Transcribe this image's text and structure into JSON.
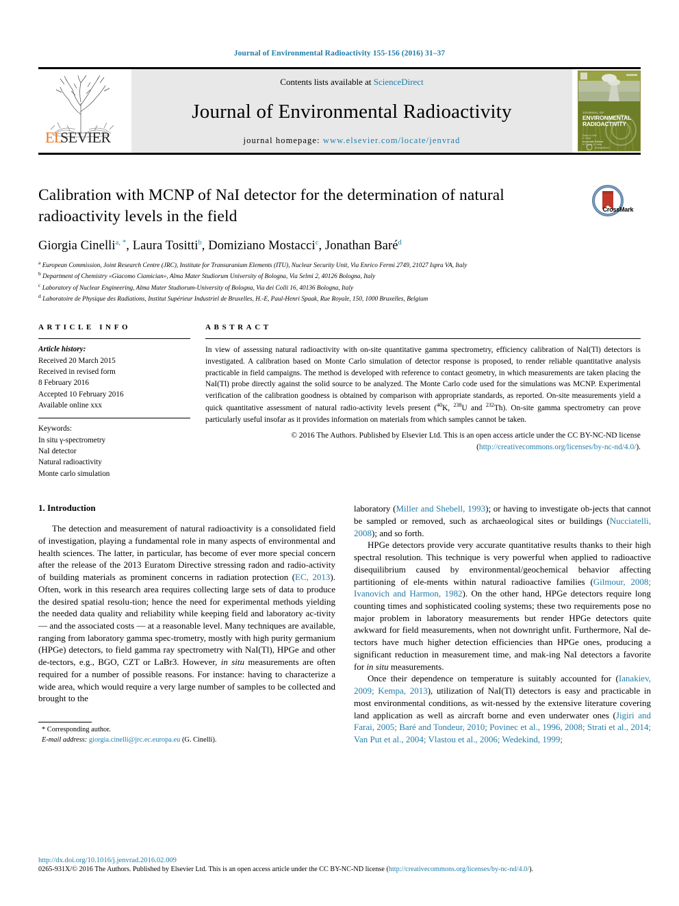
{
  "running_head": "Journal of Environmental Radioactivity 155-156 (2016) 31–37",
  "masthead": {
    "contents_prefix": "Contents lists available at ",
    "contents_link": "ScienceDirect",
    "journal_title": "Journal of Environmental Radioactivity",
    "homepage_prefix": "journal homepage: ",
    "homepage_url": "www.elsevier.com/locate/jenvrad",
    "publisher_logo": "ELSEVIER",
    "cover_title_small": "JOURNAL OF",
    "cover_title_1": "ENVIRONMENTAL",
    "cover_title_2": "RADIOACTIVITY"
  },
  "article": {
    "title": "Calibration with MCNP of NaI detector for the determination of natural radioactivity levels in the field",
    "crossmark_label": "CrossMark",
    "authors": [
      {
        "name": "Giorgia Cinelli",
        "marks": "a, *"
      },
      {
        "name": "Laura Tositti",
        "marks": "b"
      },
      {
        "name": "Domiziano Mostacci",
        "marks": "c"
      },
      {
        "name": "Jonathan Baré",
        "marks": "d"
      }
    ],
    "affiliations": [
      {
        "mark": "a",
        "text": "European Commission, Joint Research Centre (JRC), Institute for Transuranium Elements (ITU), Nuclear Security Unit, Via Enrico Fermi 2749, 21027 Ispra VA, Italy"
      },
      {
        "mark": "b",
        "text": "Department of Chemistry «Giacomo Ciamician», Alma Mater Studiorum University of Bologna, Via Selmi 2, 40126 Bologna, Italy"
      },
      {
        "mark": "c",
        "text": "Laboratory of Nuclear Engineering, Alma Mater Studiorum-University of Bologna, Via dei Colli 16, 40136 Bologna, Italy"
      },
      {
        "mark": "d",
        "text": "Laboratoire de Physique des Radiations, Institut Supérieur Industriel de Bruxelles, H.-E, Paul-Henri Spaak, Rue Royale, 150, 1000 Bruxelles, Belgium"
      }
    ]
  },
  "article_info": {
    "heading": "ARTICLE INFO",
    "history_label": "Article history:",
    "history": [
      "Received 20 March 2015",
      "Received in revised form",
      "8 February 2016",
      "Accepted 10 February 2016",
      "Available online xxx"
    ],
    "keywords_label": "Keywords:",
    "keywords": [
      "In situ γ-spectrometry",
      "NaI detector",
      "Natural radioactivity",
      "Monte carlo simulation"
    ]
  },
  "abstract": {
    "heading": "ABSTRACT",
    "part1": "In view of assessing natural radioactivity with on-site quantitative gamma spectrometry, efficiency calibration of NaI(Tl) detectors is investigated. A calibration based on Monte Carlo simulation of detector response is proposed, to render reliable quantitative analysis practicable in field campaigns. The method is developed with reference to contact geometry, in which measurements are taken placing the NaI(Tl) probe directly against the solid source to be analyzed. The Monte Carlo code used for the simulations was MCNP. Experimental verification of the calibration goodness is obtained by comparison with appropriate standards, as reported. On-site measurements yield a quick quantitative assessment of natural radio-activity levels present (",
    "iso1_sup": "40",
    "iso1": "K, ",
    "iso2_sup": "238",
    "iso2": "U and ",
    "iso3_sup": "232",
    "iso3": "Th). On-site gamma spectrometry can prove particularly useful insofar as it provides information on materials from which samples cannot be taken.",
    "copyright": "© 2016 The Authors. Published by Elsevier Ltd. This is an open access article under the CC BY-NC-ND license (",
    "copyright_link": "http://creativecommons.org/licenses/by-nc-nd/4.0/",
    "copyright_tail": ")."
  },
  "body": {
    "section_title": "1. Introduction",
    "left_p1_a": "The detection and measurement of natural radioactivity is a consolidated field of investigation, playing a fundamental role in many aspects of environmental and health sciences. The latter, in particular, has become of ever more special concern after the release of the 2013 Euratom Directive stressing radon and radio-activity of building materials as prominent concerns in radiation protection (",
    "left_p1_ref1": "EC, 2013",
    "left_p1_b": "). Often, work in this research area requires collecting large sets of data to produce the desired spatial resolu-tion; hence the need for experimental methods yielding the needed data quality and reliability while keeping field and laboratory ac-tivity — and the associated costs — at a reasonable level. Many techniques are available, ranging from laboratory gamma spec-trometry, mostly with high purity germanium (HPGe) detectors, to field gamma ray spectrometry with NaI(Tl), HPGe and other de-tectors, e.g., BGO, CZT or LaBr3. However, ",
    "left_p1_ital1": "in situ",
    "left_p1_c": " measurements are often required for a number of possible reasons. For instance: having to characterize a wide area, which would require a very large number of samples to be collected and brought to the",
    "right_p1_a": "laboratory (",
    "right_p1_ref1": "Miller and Shebell, 1993",
    "right_p1_b": "); or having to investigate ob-jects that cannot be sampled or removed, such as archaeological sites or buildings (",
    "right_p1_ref2": "Nucciatelli, 2008",
    "right_p1_c": "); and so forth.",
    "right_p2_a": "HPGe detectors provide very accurate quantitative results thanks to their high spectral resolution. This technique is very powerful when applied to radioactive disequilibrium caused by environmental/geochemical behavior affecting partitioning of ele-ments within natural radioactive families (",
    "right_p2_ref1": "Gilmour, 2008; Ivanovich and Harmon, 1982",
    "right_p2_b": "). On the other hand, HPGe detectors require long counting times and sophisticated cooling systems; these two requirements pose no major problem in laboratory measurements but render HPGe detectors quite awkward for field measurements, when not downright unfit. Furthermore, NaI de-tectors have much higher detection efficiencies than HPGe ones, producing a significant reduction in measurement time, and mak-ing NaI detectors a favorite for ",
    "right_p2_ital1": "in situ",
    "right_p2_c": " measurements.",
    "right_p3_a": "Once their dependence on temperature is suitably accounted for (",
    "right_p3_ref1": "Ianakiev, 2009; Kempa, 2013",
    "right_p3_b": "), utilization of NaI(Tl) detectors is easy and practicable in most environmental conditions, as wit-nessed by the extensive literature covering land application as well as aircraft borne and even underwater ones (",
    "right_p3_ref2": "Jigiri and Farai, 2005; Baré and Tondeur, 2010; Povinec et al., 1996, 2008; Strati et al., 2014; Van Put et al., 2004; Vlastou et al., 2006; Wedekind, 1999;"
  },
  "footnote": {
    "corresponding": "* Corresponding author.",
    "email_label": "E-mail address:",
    "email": "giorgia.cinelli@jrc.ec.europa.eu",
    "email_owner": "(G. Cinelli)."
  },
  "footer": {
    "doi": "http://dx.doi.org/10.1016/j.jenvrad.2016.02.009",
    "issn_prefix": "0265-931X/© 2016 The Authors. Published by Elsevier Ltd. This is an open access article under the CC BY-NC-ND license (",
    "issn_link": "http://creativecommons.org/licenses/by-nc-nd/4.0/",
    "issn_tail": ")."
  },
  "colors": {
    "link": "#1f7ca8",
    "elsevier_orange": "#E87722",
    "masthead_bg": "#e8e8e8"
  }
}
